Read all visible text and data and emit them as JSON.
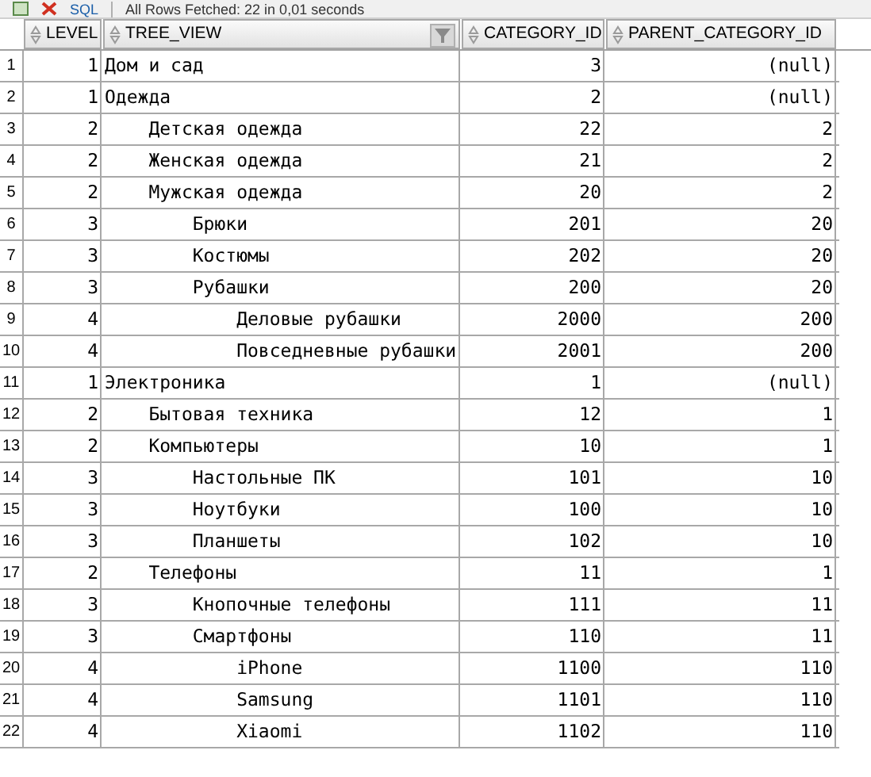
{
  "toolbar": {
    "sql_button": "SQL",
    "status": "All Rows Fetched: 22 in 0,01 seconds"
  },
  "table": {
    "columns": [
      "LEVEL",
      "TREE_VIEW",
      "CATEGORY_ID",
      "PARENT_CATEGORY_ID"
    ],
    "rows": [
      {
        "num": "1",
        "cells": [
          "1",
          "Дом и сад",
          "3",
          "(null)"
        ]
      },
      {
        "num": "2",
        "cells": [
          "1",
          "Одежда",
          "2",
          "(null)"
        ]
      },
      {
        "num": "3",
        "cells": [
          "2",
          "    Детская одежда",
          "22",
          "2"
        ]
      },
      {
        "num": "4",
        "cells": [
          "2",
          "    Женская одежда",
          "21",
          "2"
        ]
      },
      {
        "num": "5",
        "cells": [
          "2",
          "    Мужская одежда",
          "20",
          "2"
        ]
      },
      {
        "num": "6",
        "cells": [
          "3",
          "        Брюки",
          "201",
          "20"
        ]
      },
      {
        "num": "7",
        "cells": [
          "3",
          "        Костюмы",
          "202",
          "20"
        ]
      },
      {
        "num": "8",
        "cells": [
          "3",
          "        Рубашки",
          "200",
          "20"
        ]
      },
      {
        "num": "9",
        "cells": [
          "4",
          "            Деловые рубашки",
          "2000",
          "200"
        ]
      },
      {
        "num": "10",
        "cells": [
          "4",
          "            Повседневные рубашки",
          "2001",
          "200"
        ]
      },
      {
        "num": "11",
        "cells": [
          "1",
          "Электроника",
          "1",
          "(null)"
        ]
      },
      {
        "num": "12",
        "cells": [
          "2",
          "    Бытовая техника",
          "12",
          "1"
        ]
      },
      {
        "num": "13",
        "cells": [
          "2",
          "    Компьютеры",
          "10",
          "1"
        ]
      },
      {
        "num": "14",
        "cells": [
          "3",
          "        Настольные ПК",
          "101",
          "10"
        ]
      },
      {
        "num": "15",
        "cells": [
          "3",
          "        Ноутбуки",
          "100",
          "10"
        ]
      },
      {
        "num": "16",
        "cells": [
          "3",
          "        Планшеты",
          "102",
          "10"
        ]
      },
      {
        "num": "17",
        "cells": [
          "2",
          "    Телефоны",
          "11",
          "1"
        ]
      },
      {
        "num": "18",
        "cells": [
          "3",
          "        Кнопочные телефоны",
          "111",
          "11"
        ]
      },
      {
        "num": "19",
        "cells": [
          "3",
          "        Смартфоны",
          "110",
          "11"
        ]
      },
      {
        "num": "20",
        "cells": [
          "4",
          "            iPhone",
          "1100",
          "110"
        ]
      },
      {
        "num": "21",
        "cells": [
          "4",
          "            Samsung",
          "1101",
          "110"
        ]
      },
      {
        "num": "22",
        "cells": [
          "4",
          "            Xiaomi",
          "1102",
          "110"
        ]
      }
    ]
  }
}
